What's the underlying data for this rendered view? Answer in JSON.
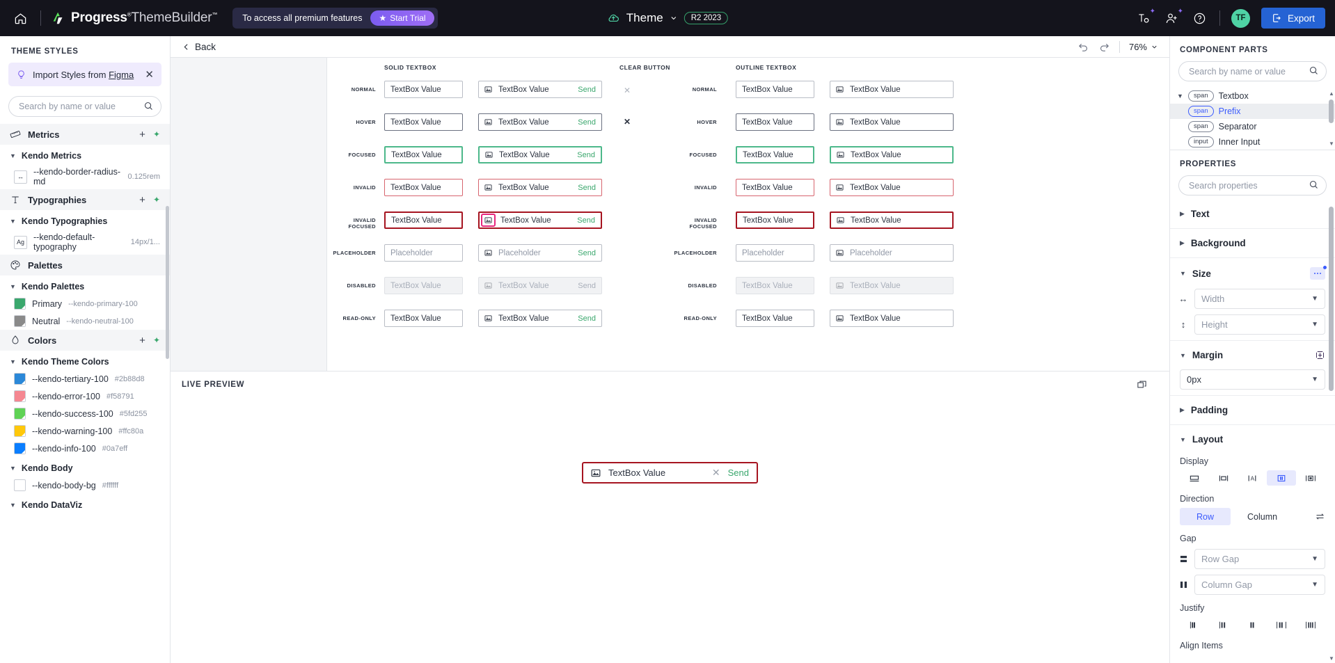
{
  "topbar": {
    "home_icon": "home-icon",
    "brand_bold": "Progress",
    "brand_reg": "ThemeBuilder",
    "brand_sup": "™",
    "brand_dot": "®",
    "trial_text": "To access all premium features",
    "trial_button": "Start Trial",
    "theme_label": "Theme",
    "version_pill": "R2 2023",
    "typography_icon": "typography-settings-icon",
    "invite_icon": "invite-user-icon",
    "help_icon": "help-circle-icon",
    "avatar_initials": "TF",
    "export_label": "Export",
    "export_icon": "export-icon"
  },
  "left": {
    "title": "THEME STYLES",
    "figma_pre": "Import Styles from ",
    "figma_link": "Figma",
    "figma_icon": "bulb-icon",
    "close_icon": "close-icon",
    "search_placeholder": "Search by name or value",
    "search_icon": "search-icon",
    "sections": [
      {
        "name": "Metrics",
        "icon": "ruler-icon",
        "group": "Kendo Metrics",
        "tokens": [
          {
            "icon": "measure-icon",
            "name": "--kendo-border-radius-md",
            "value": "0.125rem"
          }
        ]
      },
      {
        "name": "Typographies",
        "icon": "type-icon",
        "group": "Kendo Typographies",
        "tokens": [
          {
            "icon": "Ag",
            "name": "--kendo-default-typography",
            "value": "14px/1..."
          }
        ]
      },
      {
        "name": "Palettes",
        "icon": "palette-icon",
        "group": "Kendo Palettes",
        "tokens": [
          {
            "swatch": "#3aa76d",
            "name": "Primary",
            "value": "--kendo-primary-100"
          },
          {
            "swatch": "#8a8a8a",
            "name": "Neutral",
            "value": "--kendo-neutral-100"
          }
        ]
      },
      {
        "name": "Colors",
        "icon": "droplet-icon",
        "group": "Kendo Theme Colors",
        "tokens": [
          {
            "swatch": "#2b88d8",
            "name": "--kendo-tertiary-100",
            "value": "#2b88d8"
          },
          {
            "swatch": "#f58791",
            "name": "--kendo-error-100",
            "value": "#f58791"
          },
          {
            "swatch": "#5fd255",
            "name": "--kendo-success-100",
            "value": "#5fd255"
          },
          {
            "swatch": "#ffc80a",
            "name": "--kendo-warning-100",
            "value": "#ffc80a"
          },
          {
            "swatch": "#0a7eff",
            "name": "--kendo-info-100",
            "value": "#0a7eff"
          }
        ],
        "group2": "Kendo Body",
        "tokens2": [
          {
            "swatch": "#ffffff",
            "name": "--kendo-body-bg",
            "value": "#ffffff"
          }
        ],
        "group3": "Kendo DataViz"
      }
    ]
  },
  "center": {
    "back_label": "Back",
    "back_icon": "chevron-left-icon",
    "undo_icon": "undo-icon",
    "redo_icon": "redo-icon",
    "zoom_value": "76%",
    "zoom_chevron": "chevron-down-icon",
    "columns": [
      {
        "title": "SOLID TEXTBOX"
      },
      {
        "title": "CLEAR BUTTON"
      },
      {
        "title": "OUTLINE TEXTBOX"
      }
    ],
    "rows": [
      "NORMAL",
      "HOVER",
      "FOCUSED",
      "INVALID",
      "INVALID FOCUSED",
      "PLACEHOLDER",
      "DISABLED",
      "READ-ONLY"
    ],
    "textbox_value": "TextBox Value",
    "placeholder_value": "Placeholder",
    "send_label": "Send",
    "prefix_icon": "image-icon",
    "clear_icon": "close-icon"
  },
  "preview": {
    "title": "LIVE PREVIEW",
    "expand_icon": "expand-preview-icon",
    "value": "TextBox Value",
    "clear_icon": "close-icon",
    "send_label": "Send",
    "prefix_icon": "image-icon"
  },
  "right": {
    "parts_title": "COMPONENT PARTS",
    "parts_search_placeholder": "Search by name or value",
    "search_icon": "search-icon",
    "parts": [
      {
        "tag": "span",
        "label": "Textbox",
        "expanded": true,
        "selected": false
      },
      {
        "tag": "span",
        "label": "Prefix",
        "expanded": false,
        "selected": true
      },
      {
        "tag": "span",
        "label": "Separator",
        "expanded": false,
        "selected": false
      },
      {
        "tag": "input",
        "label": "Inner Input",
        "expanded": false,
        "selected": false
      }
    ],
    "props_title": "PROPERTIES",
    "props_search_placeholder": "Search properties",
    "sections": [
      {
        "name": "Text",
        "open": false
      },
      {
        "name": "Background",
        "open": false
      },
      {
        "name": "Size",
        "open": true
      },
      {
        "name": "Margin",
        "open": true
      },
      {
        "name": "Padding",
        "open": false
      },
      {
        "name": "Layout",
        "open": true
      }
    ],
    "width_placeholder": "Width",
    "height_placeholder": "Height",
    "width_icon": "horizontal-arrows-icon",
    "height_icon": "vertical-arrows-icon",
    "margin_value": "0px",
    "margin_icon": "margin-box-icon",
    "display_label": "Display",
    "display_options": [
      "block",
      "inline-block",
      "inline",
      "flex",
      "inline-flex"
    ],
    "display_selected_index": 3,
    "direction_label": "Direction",
    "direction_row": "Row",
    "direction_column": "Column",
    "direction_selected": "Row",
    "swap_icon": "swap-icon",
    "gap_label": "Gap",
    "row_gap_placeholder": "Row Gap",
    "column_gap_placeholder": "Column Gap",
    "row_gap_icon": "row-gap-icon",
    "column_gap_icon": "column-gap-icon",
    "justify_label": "Justify",
    "align_label": "Align Items"
  }
}
